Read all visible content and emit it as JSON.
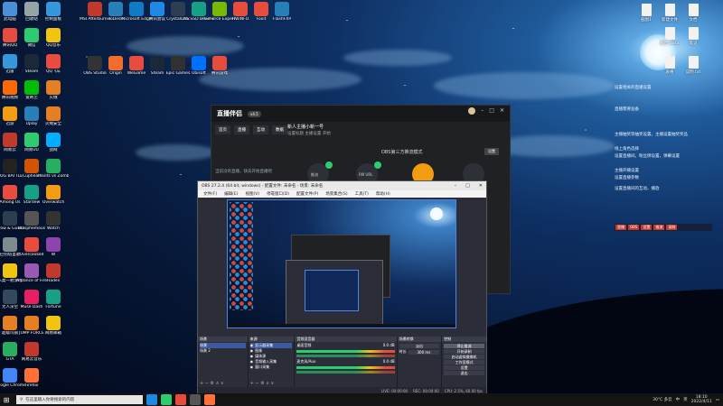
{
  "desktop": {
    "icons_col1": [
      {
        "label": "此电脑",
        "color": "#4a90d9"
      },
      {
        "label": "腾讯QQ",
        "color": "#e74c3c"
      },
      {
        "label": "迅雷",
        "color": "#3498db"
      },
      {
        "label": "腾讯视频",
        "color": "#ff6a00"
      },
      {
        "label": "迅游",
        "color": "#f39c12"
      },
      {
        "label": "网易云",
        "color": "#c0392b"
      },
      {
        "label": "ROG BATTLE",
        "color": "#222"
      },
      {
        "label": "Among Us",
        "color": "#e74c3c"
      },
      {
        "label": "Grow & Guess",
        "color": "#2c3e50"
      },
      {
        "label": "巴别塔圣歌",
        "color": "#7f8c8d"
      },
      {
        "label": "人类一败涂地",
        "color": "#f1c40f"
      },
      {
        "label": "无人深空",
        "color": "#34495e"
      },
      {
        "label": "超级玛丽",
        "color": "#e67e22"
      },
      {
        "label": "GTA",
        "color": "#27ae60"
      },
      {
        "label": "Google Chrome",
        "color": "#4285f4"
      }
    ],
    "icons_col2": [
      {
        "label": "回收站",
        "color": "#95a5a6"
      },
      {
        "label": "微信",
        "color": "#2ecc71"
      },
      {
        "label": "Steam",
        "color": "#1b2838"
      },
      {
        "label": "爱奇艺",
        "color": "#00be06"
      },
      {
        "label": "Uplay",
        "color": "#2980b9"
      },
      {
        "label": "网易UU",
        "color": "#2ecc71"
      },
      {
        "label": "Cuphead",
        "color": "#d35400"
      },
      {
        "label": "Stardew",
        "color": "#16a085"
      },
      {
        "label": "Blasphemous",
        "color": "#555"
      },
      {
        "label": "Overcooked",
        "color": "#e74c3c"
      },
      {
        "label": "A Dance of Fire",
        "color": "#9b59b6"
      },
      {
        "label": "Muse Dash",
        "color": "#e91e63"
      },
      {
        "label": "JUMP FORCE",
        "color": "#e67e22"
      },
      {
        "label": "网易云音乐",
        "color": "#c0392b"
      },
      {
        "label": "Firefox",
        "color": "#ff7139"
      }
    ],
    "icons_col3": [
      {
        "label": "控制面板",
        "color": "#3498db"
      },
      {
        "label": "QQ音乐",
        "color": "#f1c40f"
      },
      {
        "label": "QQ飞车",
        "color": "#e74c3c"
      },
      {
        "label": "火绒",
        "color": "#e67e22"
      },
      {
        "label": "火绒安全",
        "color": "#e67e22"
      },
      {
        "label": "战网",
        "color": "#00aeff"
      },
      {
        "label": "Plants vs Zombies",
        "color": "#27ae60"
      },
      {
        "label": "Overwatch",
        "color": "#f39c12"
      },
      {
        "label": "Watch",
        "color": "#333"
      },
      {
        "label": "W",
        "color": "#8e44ad"
      },
      {
        "label": "Hades",
        "color": "#c0392b"
      },
      {
        "label": "Fortune",
        "color": "#16a085"
      },
      {
        "label": "网易邮箱",
        "color": "#f1c40f"
      }
    ],
    "icons_top": [
      {
        "label": "MSI Afterburner",
        "color": "#c0392b"
      },
      {
        "label": "ToDesk",
        "color": "#2980b9"
      },
      {
        "label": "Microsoft Edge",
        "color": "#0f7ac6"
      },
      {
        "label": "腾讯会议",
        "color": "#1e88e5"
      },
      {
        "label": "CrystalDisk",
        "color": "#2c3e50"
      },
      {
        "label": "AS SSD Benchmark",
        "color": "#16a085"
      },
      {
        "label": "GeForce Experience",
        "color": "#76b900"
      },
      {
        "label": "HWiNFO",
        "color": "#e74c3c"
      },
      {
        "label": "Foxit",
        "color": "#e74c3c"
      },
      {
        "label": "FlashFXP",
        "color": "#2980b9"
      },
      {
        "label": "OBS Studio",
        "color": "#333"
      },
      {
        "label": "Origin",
        "color": "#f56c2d"
      },
      {
        "label": "WeGame",
        "color": "#e74c3c"
      },
      {
        "label": "Steam",
        "color": "#1b2838"
      },
      {
        "label": "Epic Games",
        "color": "#313131"
      },
      {
        "label": "Ubisoft",
        "color": "#0070ff"
      },
      {
        "label": "腾讯游戏",
        "color": "#e74c3c"
      }
    ],
    "files_right": [
      {
        "label": "截图1"
      },
      {
        "label": "新建文件"
      },
      {
        "label": "文档"
      },
      {
        "label": "报告.docx"
      },
      {
        "label": "笔记"
      },
      {
        "label": "表格"
      },
      {
        "label": "说明.txt"
      }
    ],
    "notes_right": [
      "设置相关的直播设置",
      "直播需要准备",
      "主播抽奖等抽奖设置，主播设置抽奖奖品",
      "线上角色选择",
      "设置直播间，粉丝牌设置，弹幕设置",
      "主播开播设置",
      "设置直播参数",
      "设置直播间的互动，播放"
    ],
    "dashboard": [
      "直播",
      "OBS",
      "设置",
      "推流",
      "录制"
    ]
  },
  "streaming_app": {
    "logo": "直播伴侣",
    "version": "v4.5",
    "tabs": [
      "首页",
      "直播",
      "互动",
      "数据"
    ],
    "room_title": "新人主播小新一号",
    "room_tags": "设置标题  主播设置  开始",
    "mode_label": "OBS第三方推流模式",
    "settings_btn": "设置",
    "sidebar_text": "当前没有直播，快去开始直播吧",
    "circles": [
      "推流",
      "RM URL",
      "推流码",
      "开始直播"
    ]
  },
  "obs": {
    "title": "OBS 27.2.4 (64 bit, windows) - 配置文件: 未命名 - 场景: 未命名",
    "menu": [
      "文件(F)",
      "编辑(E)",
      "视图(V)",
      "停靠窗口(D)",
      "配置文件(P)",
      "场景集合(S)",
      "工具(T)",
      "帮助(H)"
    ],
    "docks": {
      "scenes": {
        "title": "场景",
        "items": [
          "场景",
          "场景 2"
        ]
      },
      "sources": {
        "title": "来源",
        "items": [
          "显示器采集",
          "图像",
          "媒体源",
          "音频输入采集",
          "窗口采集"
        ]
      },
      "mixer": {
        "title": "音频混音器",
        "tracks": [
          "桌面音频",
          "麦克风/Aux"
        ],
        "levels": [
          "0.0 dB",
          "0.0 dB"
        ]
      },
      "transitions": {
        "title": "场景转换",
        "type": "淡出",
        "duration_label": "时长",
        "duration": "300 ms"
      },
      "controls": {
        "title": "控制",
        "buttons": [
          "停止推流",
          "开始录制",
          "启动虚拟摄像机",
          "工作室模式",
          "设置",
          "退出"
        ]
      }
    },
    "status": [
      "LIVE: 00:00:00",
      "REC: 00:00:00",
      "CPU: 2.5%, 60.00 fps"
    ]
  },
  "taskbar": {
    "start_icon": "windows-icon",
    "search_placeholder": "在这里输入你要搜索的内容",
    "apps": [
      "#1e88e5",
      "#2ecc71",
      "#e74c3c",
      "#555",
      "#ff7139"
    ],
    "tray": [
      "30°C 多云",
      "中",
      "英"
    ],
    "time": "18:10",
    "date": "2022/4/11"
  }
}
